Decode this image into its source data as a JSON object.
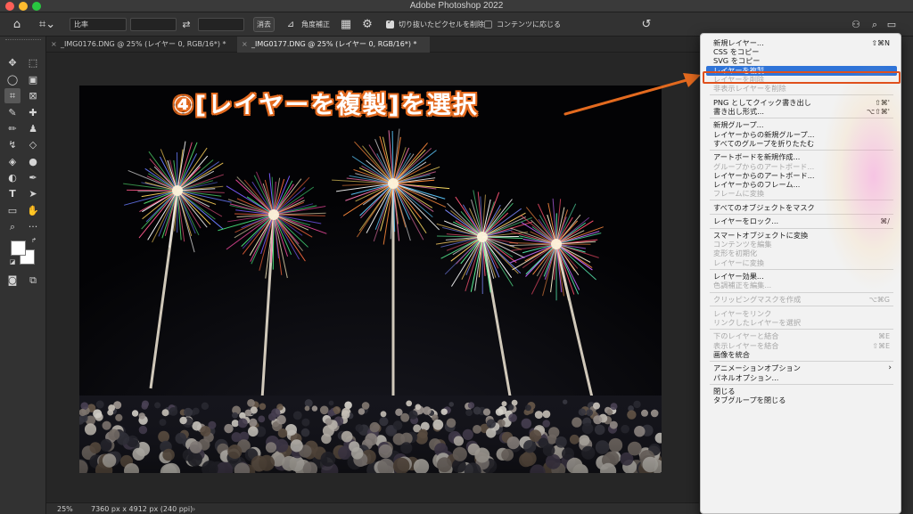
{
  "window": {
    "title": "Adobe Photoshop 2022"
  },
  "options_bar": {
    "ratio_label": "比率",
    "clear_button": "消去",
    "straighten_label": "角度補正",
    "delete_cropped_label": "切り抜いたピクセルを削除",
    "delete_cropped_checked": true,
    "content_aware_label": "コンテンツに応じる",
    "content_aware_checked": false
  },
  "tabs": [
    {
      "close": "×",
      "label": "_IMG0176.DNG @ 25% (レイヤー 0, RGB/16*) *",
      "active": false
    },
    {
      "close": "×",
      "label": "_IMG0177.DNG @ 25% (レイヤー 0, RGB/16*) *",
      "active": true
    }
  ],
  "status": {
    "zoom": "25%",
    "dimensions": "7360 px x 4912 px (240 ppi)",
    "arrow": "›"
  },
  "annotation": {
    "text": "④[レイヤーを複製]を選択",
    "color": "#e36a1f"
  },
  "menu": {
    "highlight_color": "#2f74d8",
    "items": [
      {
        "label": "新規レイヤー...",
        "shortcut": "⇧⌘N",
        "state": "enabled"
      },
      {
        "label": "CSS をコピー",
        "state": "enabled"
      },
      {
        "label": "SVG をコピー",
        "state": "enabled"
      },
      {
        "label": "レイヤーを複製...",
        "state": "highlighted"
      },
      {
        "label": "レイヤーを削除",
        "state": "disabled"
      },
      {
        "label": "非表示レイヤーを削除",
        "state": "disabled"
      },
      {
        "sep": true
      },
      {
        "label": "PNG としてクイック書き出し",
        "shortcut": "⇧⌘'",
        "state": "enabled"
      },
      {
        "label": "書き出し形式...",
        "shortcut": "⌥⇧⌘'",
        "state": "enabled"
      },
      {
        "sep": true
      },
      {
        "label": "新規グループ...",
        "state": "enabled"
      },
      {
        "label": "レイヤーからの新規グループ...",
        "state": "enabled"
      },
      {
        "label": "すべてのグループを折りたたむ",
        "state": "enabled"
      },
      {
        "sep": true
      },
      {
        "label": "アートボードを新規作成...",
        "state": "enabled"
      },
      {
        "label": "グループからのアートボード...",
        "state": "disabled"
      },
      {
        "label": "レイヤーからのアートボード...",
        "state": "enabled"
      },
      {
        "label": "レイヤーからのフレーム...",
        "state": "enabled"
      },
      {
        "label": "フレームに変換",
        "state": "disabled"
      },
      {
        "sep": true
      },
      {
        "label": "すべてのオブジェクトをマスク",
        "state": "enabled"
      },
      {
        "sep": true
      },
      {
        "label": "レイヤーをロック...",
        "shortcut": "⌘/",
        "state": "enabled"
      },
      {
        "sep": true
      },
      {
        "label": "スマートオブジェクトに変換",
        "state": "enabled"
      },
      {
        "label": "コンテンツを編集",
        "state": "disabled"
      },
      {
        "label": "変形を初期化",
        "state": "disabled"
      },
      {
        "label": "レイヤーに変換",
        "state": "disabled"
      },
      {
        "sep": true
      },
      {
        "label": "レイヤー効果...",
        "state": "enabled"
      },
      {
        "label": "色調補正を編集...",
        "state": "disabled"
      },
      {
        "sep": true
      },
      {
        "label": "クリッピングマスクを作成",
        "shortcut": "⌥⌘G",
        "state": "disabled"
      },
      {
        "sep": true
      },
      {
        "label": "レイヤーをリンク",
        "state": "disabled"
      },
      {
        "label": "リンクしたレイヤーを選択",
        "state": "disabled"
      },
      {
        "sep": true
      },
      {
        "label": "下のレイヤーと結合",
        "shortcut": "⌘E",
        "state": "disabled"
      },
      {
        "label": "表示レイヤーを結合",
        "shortcut": "⇧⌘E",
        "state": "disabled"
      },
      {
        "label": "画像を統合",
        "state": "enabled"
      },
      {
        "sep": true
      },
      {
        "label": "アニメーションオプション",
        "submenu": "›",
        "state": "enabled"
      },
      {
        "label": "パネルオプション...",
        "state": "enabled"
      },
      {
        "sep": true
      },
      {
        "label": "閉じる",
        "state": "enabled"
      },
      {
        "label": "タブグループを閉じる",
        "state": "enabled"
      }
    ]
  }
}
